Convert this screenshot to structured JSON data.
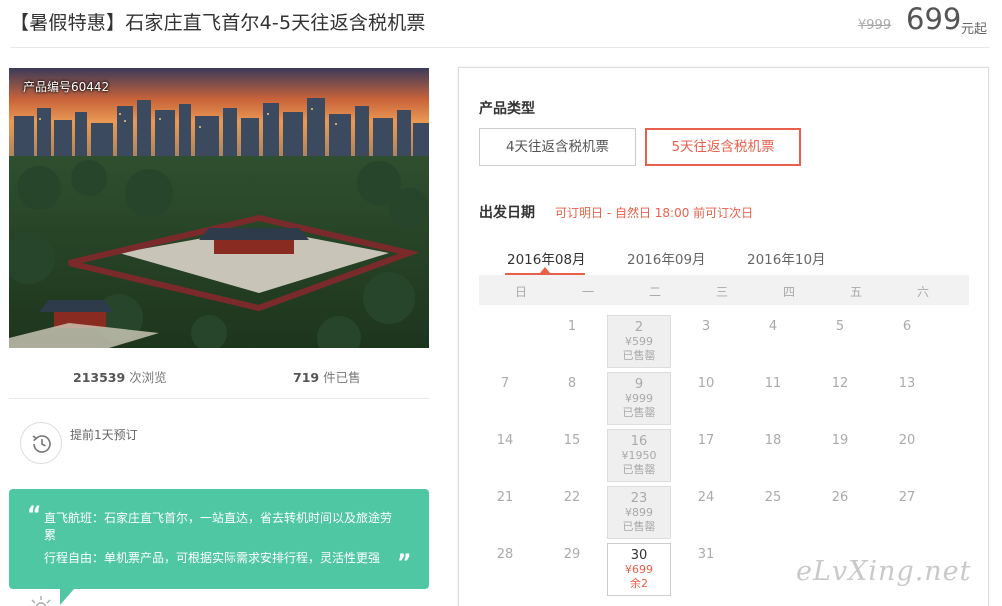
{
  "header": {
    "title": "【暑假特惠】石家庄直飞首尔4-5天往返含税机票",
    "original_price": "¥999",
    "price": "699",
    "price_unit": "元起"
  },
  "photo": {
    "product_no": "产品编号60442"
  },
  "stats": {
    "views_count": "213539",
    "views_label": "次浏览",
    "sold_count": "719",
    "sold_label": "件已售"
  },
  "booking_notice": {
    "icon": "clock-icon",
    "text": "提前1天预订"
  },
  "highlights": {
    "quote_open": "“",
    "quote_close": "”",
    "line1": "直飞航班：石家庄直飞首尔，一站直达，省去转机时间以及旅途劳累",
    "line2": "行程自由：单机票产品，可根据实际需求安排行程，灵活性更强"
  },
  "panel": {
    "product_type_label": "产品类型",
    "product_types": [
      {
        "label": "4天往返含税机票",
        "selected": false
      },
      {
        "label": "5天往返含税机票",
        "selected": true
      }
    ],
    "departure_label": "出发日期",
    "departure_note": "可订明日 - 自然日 18:00 前可订次日",
    "months": [
      {
        "label": "2016年08月",
        "active": true
      },
      {
        "label": "2016年09月",
        "active": false
      },
      {
        "label": "2016年10月",
        "active": false
      }
    ],
    "weekdays": [
      "日",
      "一",
      "二",
      "三",
      "四",
      "五",
      "六"
    ],
    "days": [
      {
        "d": "1",
        "state": "none"
      },
      {
        "d": "2",
        "state": "soldout",
        "price": "¥599",
        "status": "已售罄"
      },
      {
        "d": "3",
        "state": "none"
      },
      {
        "d": "4",
        "state": "none"
      },
      {
        "d": "5",
        "state": "none"
      },
      {
        "d": "6",
        "state": "none"
      },
      {
        "d": "7",
        "state": "none"
      },
      {
        "d": "8",
        "state": "none"
      },
      {
        "d": "9",
        "state": "soldout",
        "price": "¥999",
        "status": "已售罄"
      },
      {
        "d": "10",
        "state": "none"
      },
      {
        "d": "11",
        "state": "none"
      },
      {
        "d": "12",
        "state": "none"
      },
      {
        "d": "13",
        "state": "none"
      },
      {
        "d": "14",
        "state": "none"
      },
      {
        "d": "15",
        "state": "none"
      },
      {
        "d": "16",
        "state": "soldout",
        "price": "¥1950",
        "status": "已售罄"
      },
      {
        "d": "17",
        "state": "none"
      },
      {
        "d": "18",
        "state": "none"
      },
      {
        "d": "19",
        "state": "none"
      },
      {
        "d": "20",
        "state": "none"
      },
      {
        "d": "21",
        "state": "none"
      },
      {
        "d": "22",
        "state": "none"
      },
      {
        "d": "23",
        "state": "soldout",
        "price": "¥899",
        "status": "已售罄"
      },
      {
        "d": "24",
        "state": "none"
      },
      {
        "d": "25",
        "state": "none"
      },
      {
        "d": "26",
        "state": "none"
      },
      {
        "d": "27",
        "state": "none"
      },
      {
        "d": "28",
        "state": "none"
      },
      {
        "d": "29",
        "state": "none"
      },
      {
        "d": "30",
        "state": "avail",
        "price": "¥699",
        "status": "余2"
      },
      {
        "d": "31",
        "state": "none"
      }
    ],
    "first_weekday_offset": 1
  },
  "watermark": "eLvXing.net",
  "colors": {
    "accent": "#e8604c",
    "highlight_bg": "#4fc7a2"
  }
}
